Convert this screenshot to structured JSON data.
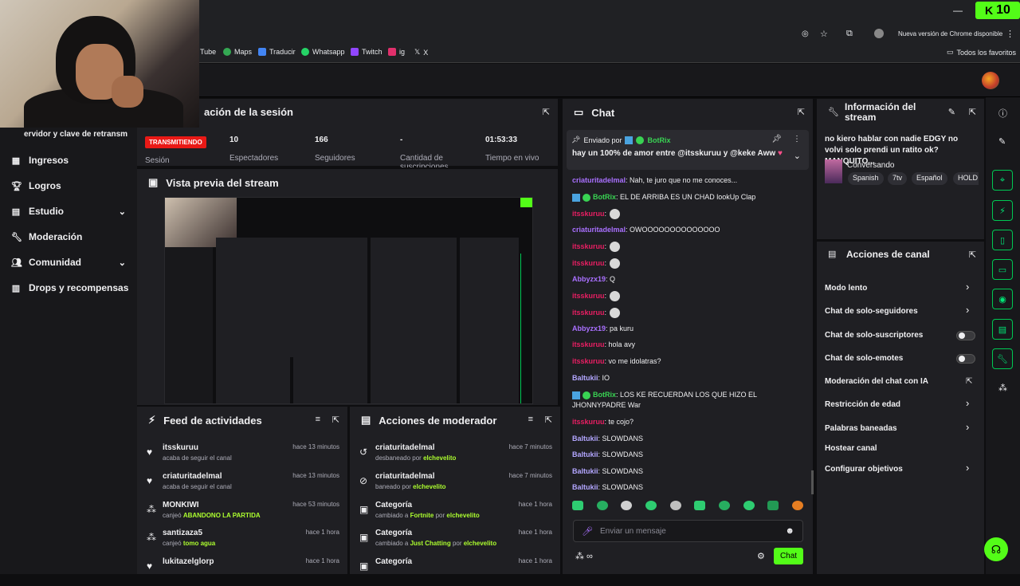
{
  "browser": {
    "update_text": "Nueva versión de Chrome disponible",
    "kick_count": "10",
    "bookmarks": [
      "Tube",
      "Maps",
      "Traducir",
      "Whatsapp",
      "Twitch",
      "ig",
      "X"
    ],
    "all_favorites": "Todos los favoritos"
  },
  "sidebar": {
    "partial_text": "ervidor y clave de retransm",
    "items": [
      {
        "label": "Ingresos",
        "icon": "income-icon"
      },
      {
        "label": "Logros",
        "icon": "trophy-icon"
      },
      {
        "label": "Estudio",
        "icon": "studio-icon"
      },
      {
        "label": "Moderación",
        "icon": "wrench-icon"
      },
      {
        "label": "Comunidad",
        "icon": "community-icon"
      },
      {
        "label": "Drops y recompensas",
        "icon": "drops-icon"
      }
    ]
  },
  "session": {
    "title": "ación de la sesión",
    "live_badge": "TRANSMITIENDO",
    "session_label": "Sesión",
    "stats": [
      {
        "value": "10",
        "label": "Espectadores"
      },
      {
        "value": "166",
        "label": "Seguidores"
      },
      {
        "value": "-",
        "label": "Cantidad de suscripciones"
      },
      {
        "value": "01:53:33",
        "label": "Tiempo en vivo"
      }
    ]
  },
  "preview": {
    "title": "Vista previa del stream"
  },
  "activity": {
    "title": "Feed de actividades",
    "rows": [
      {
        "user": "itsskuruu",
        "desc": "acaba de seguir el canal",
        "highlight": "",
        "time": "hace 13 minutos",
        "icon": "heart-icon"
      },
      {
        "user": "criaturitadelmal",
        "desc": "acaba de seguir el canal",
        "highlight": "",
        "time": "hace 13 minutos",
        "icon": "heart-icon"
      },
      {
        "user": "MONKIWI",
        "desc": "canjeó",
        "highlight": "ABANDONO LA PARTIDA",
        "time": "hace 53 minutos",
        "icon": "points-icon"
      },
      {
        "user": "santizaza5",
        "desc": "canjeó",
        "highlight": "tomo agua",
        "time": "hace 1 hora",
        "icon": "points-icon"
      },
      {
        "user": "lukitazelglorp",
        "desc": "",
        "highlight": "",
        "time": "hace 1 hora",
        "icon": "heart-icon"
      }
    ]
  },
  "modactions": {
    "title": "Acciones de moderador",
    "rows": [
      {
        "user": "criaturitadelmal",
        "desc": "desbaneado por",
        "highlight": "elchevelito",
        "time": "hace 7 minutos",
        "icon": "unban-icon"
      },
      {
        "user": "criaturitadelmal",
        "desc": "baneado por",
        "highlight": "elchevelito",
        "time": "hace 7 minutos",
        "icon": "ban-icon"
      },
      {
        "user": "Categoría",
        "desc": "cambiado a",
        "highlight": "Fortnite",
        "extra": "por",
        "extra_highlight": "elchevelito",
        "time": "hace 1 hora",
        "icon": "category-icon"
      },
      {
        "user": "Categoría",
        "desc": "cambiado a",
        "highlight": "Just Chatting",
        "extra": "por",
        "extra_highlight": "elchevelito",
        "time": "hace 1 hora",
        "icon": "category-icon"
      },
      {
        "user": "Categoría",
        "desc": "",
        "highlight": "",
        "time": "hace 1 hora",
        "icon": "category-icon"
      }
    ]
  },
  "chat": {
    "title": "Chat",
    "pinned_by_label": "Enviado por",
    "pinned_user": "BotRix",
    "pinned_text": "hay un 100% de amor entre @itsskuruu y @keke Aww",
    "messages": [
      {
        "user": "criaturitadelmal",
        "text": ": Nah, te juro que no me conoces...",
        "cls": "u-purple"
      },
      {
        "user": "BotRix",
        "text": ": EL DE ARRIBA ES UN CHAD lookUp Clap",
        "cls": "u-green"
      },
      {
        "user": "itsskuruu",
        "text": ":",
        "cls": "u-red",
        "emote": true
      },
      {
        "user": "criaturitadelmal",
        "text": ": OWOOOOOOOOOOOOOO",
        "cls": "u-purple"
      },
      {
        "user": "itsskuruu",
        "text": ":",
        "cls": "u-red",
        "emote": true
      },
      {
        "user": "itsskuruu",
        "text": ":",
        "cls": "u-red",
        "emote": true
      },
      {
        "user": "Abbyzx19",
        "text": ": Q",
        "cls": "u-purple"
      },
      {
        "user": "itsskuruu",
        "text": ":",
        "cls": "u-red",
        "emote": true
      },
      {
        "user": "itsskuruu",
        "text": ":",
        "cls": "u-red",
        "emote": true
      },
      {
        "user": "Abbyzx19",
        "text": ": pa kuru",
        "cls": "u-purple"
      },
      {
        "user": "itsskuruu",
        "text": ": hola avy",
        "cls": "u-red"
      },
      {
        "user": "itsskuruu",
        "text": ": vo me idolatras?",
        "cls": "u-red"
      },
      {
        "user": "Baltukii",
        "text": ": IO",
        "cls": "u-lav"
      },
      {
        "user": "BotRix",
        "text": ": LOS KE RECUERDAN LOS QUE HIZO EL",
        "cls": "u-green"
      },
      {
        "user": "",
        "text": "JHONNYPADRE War",
        "cls": ""
      },
      {
        "user": "itsskuruu",
        "text": ": te cojo?",
        "cls": "u-red"
      },
      {
        "user": "Baltukii",
        "text": ": SLOWDANS",
        "cls": "u-lav"
      },
      {
        "user": "Baltukii",
        "text": ": SLOWDANS",
        "cls": "u-lav"
      },
      {
        "user": "Baltukii",
        "text": ": SLOWDANS",
        "cls": "u-lav"
      },
      {
        "user": "Baltukii",
        "text": ": SLOWDANS",
        "cls": "u-lav"
      }
    ],
    "input_placeholder": "Enviar un mensaje",
    "send_label": "Chat"
  },
  "stream_info": {
    "title": "Información del stream",
    "stream_title": "no kiero hablar con nadie EDGY no volvi solo prendi un ratito ok? MANQUITO...",
    "category": "Conversando",
    "tags": [
      "Spanish",
      "7tv",
      "Español",
      "HOLD"
    ]
  },
  "channel_actions": {
    "title": "Acciones de canal",
    "items": [
      {
        "label": "Modo lento",
        "control": "arrow"
      },
      {
        "label": "Chat de solo-seguidores",
        "control": "arrow"
      },
      {
        "label": "Chat de solo-suscriptores",
        "control": "toggle"
      },
      {
        "label": "Chat de solo-emotes",
        "control": "toggle"
      },
      {
        "label": "Moderación del chat con IA",
        "control": "external"
      },
      {
        "label": "Restricción de edad",
        "control": "arrow"
      },
      {
        "label": "Palabras baneadas",
        "control": "arrow"
      },
      {
        "label": "Hostear canal",
        "control": "none"
      },
      {
        "label": "Configurar objetivos",
        "control": "arrow"
      }
    ]
  },
  "colors": {
    "accent": "#53fc18",
    "live": "#e91916",
    "panel": "#1f1f23",
    "bg": "#0e0e10"
  }
}
